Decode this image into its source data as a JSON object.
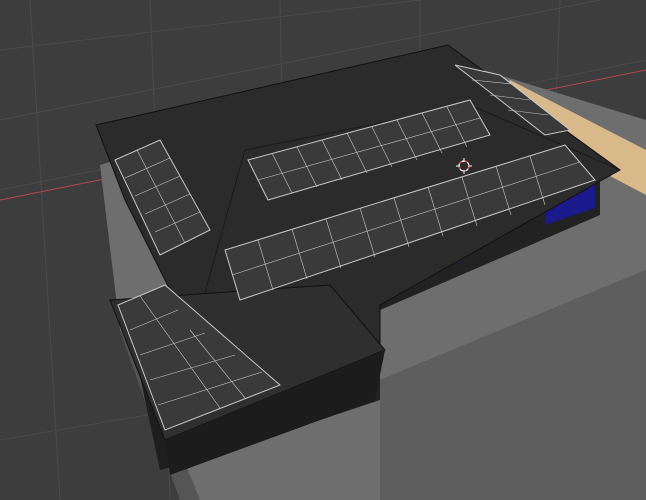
{
  "viewport": {
    "background": "#3d3d3d",
    "grid_color": "#4a4a4a",
    "x_axis_color": "#b5474f",
    "ground_color": "#6e6e6e",
    "floor_color": "#d9b88a",
    "roof_color": "#2b2b2b",
    "wall_color": "#1f1f1f",
    "window_color": "#1a1a8c",
    "panel_fill": "#3a3a3a",
    "panel_line": "#c8c8c8",
    "icons": [
      "3d-cursor-icon"
    ]
  }
}
